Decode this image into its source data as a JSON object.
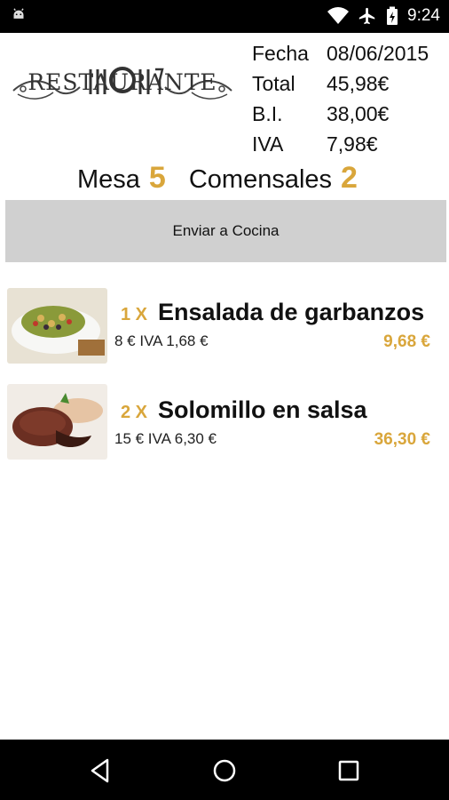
{
  "status_bar": {
    "time": "9:24",
    "icons": [
      "android-icon",
      "wifi-icon",
      "airplane-mode-icon",
      "battery-charging-icon"
    ]
  },
  "brand": {
    "logo_text": "RESTAURANTE"
  },
  "summary": {
    "fecha_label": "Fecha",
    "fecha_value": "08/06/2015",
    "total_label": "Total",
    "total_value": "45,98€",
    "bi_label": "B.I.",
    "bi_value": "38,00€",
    "iva_label": "IVA",
    "iva_value": "7,98€"
  },
  "table": {
    "mesa_label": "Mesa",
    "mesa_value": "5",
    "comensales_label": "Comensales",
    "comensales_value": "2"
  },
  "actions": {
    "send_kitchen_label": "Enviar a Cocina"
  },
  "order_items": [
    {
      "qty": "1 X",
      "name": "Ensalada de garbanzos",
      "detail": "8 € IVA 1,68 €",
      "price": "9,68 €",
      "photo": "chickpea-salad-photo"
    },
    {
      "qty": "2 X",
      "name": "Solomillo en salsa",
      "detail": "15 € IVA 6,30 €",
      "price": "36,30 €",
      "photo": "sirloin-in-sauce-photo"
    }
  ],
  "nav": {
    "icons": [
      "back-icon",
      "home-icon",
      "recents-icon"
    ]
  },
  "colors": {
    "accent": "#d9a63b",
    "button_bg": "#d0d0d0",
    "bar_bg": "#000000"
  }
}
